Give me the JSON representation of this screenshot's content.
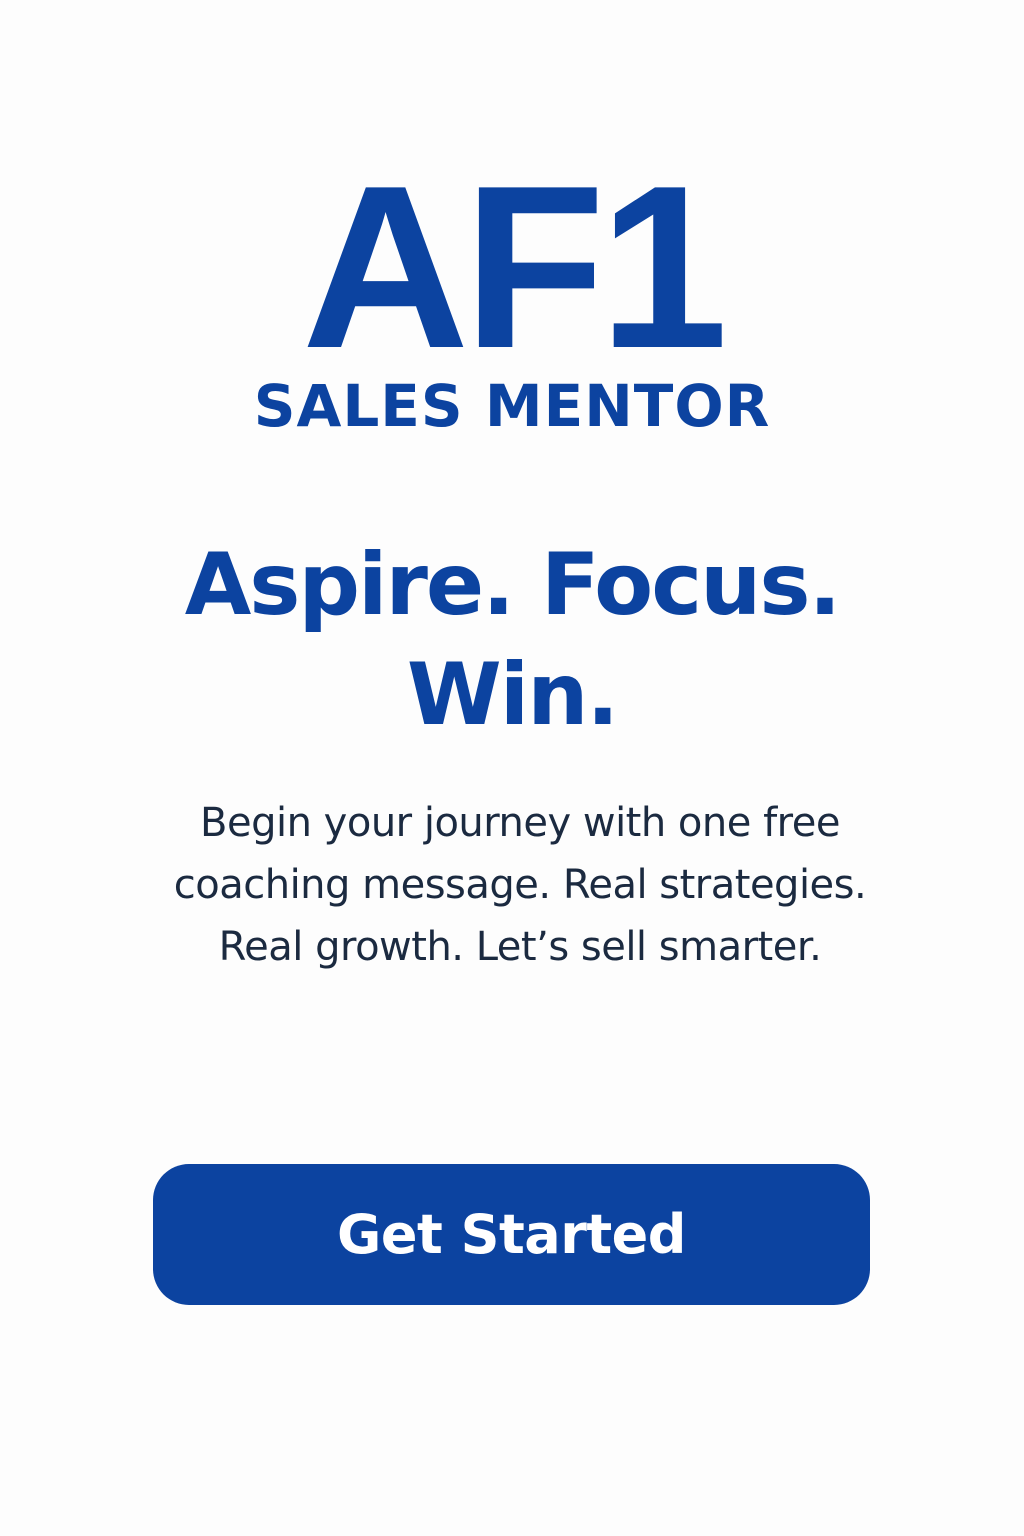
{
  "brand": {
    "logo_text": "AF1",
    "subtitle": "SALES MENTOR",
    "color": "#0c43a0"
  },
  "hero": {
    "headline_line1": "Aspire. Focus.",
    "headline_line2": "Win.",
    "body_line1": "Begin your journey with one free",
    "body_line2": "coaching message. Real strategies.",
    "body_line3": "Real growth. Let’s sell smarter."
  },
  "cta": {
    "label": "Get Started",
    "color": "#0c43a0"
  }
}
